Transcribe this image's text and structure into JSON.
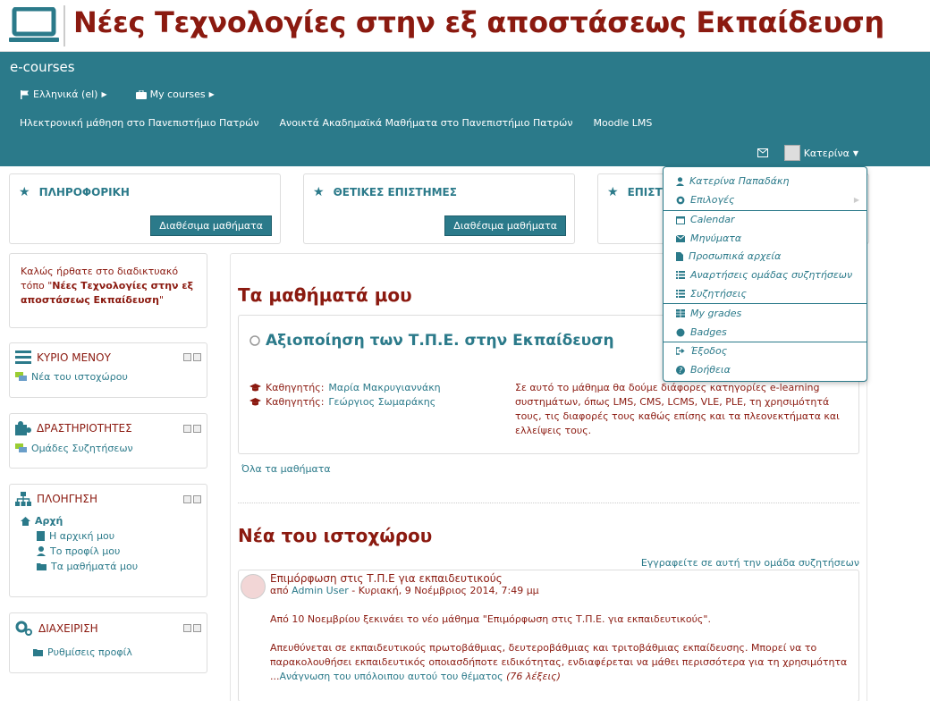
{
  "site_title": "Νέες Τεχνολογίες στην εξ αποστάσεως Εκπαίδευση",
  "brand": "e-courses",
  "nav": {
    "language": "Ελληνικά (el)",
    "my_courses": "My courses",
    "links": [
      "Ηλεκτρονική μάθηση στο Πανεπιστήμιο Πατρών",
      "Ανοικτά Ακαδημαϊκά Μαθήματα στο Πανεπιστήμιο Πατρών",
      "Moodle LMS"
    ],
    "user": "Κατερίνα"
  },
  "categories": [
    {
      "title": "ΠΛΗΡΟΦΟΡΙΚΗ",
      "button": "Διαθέσιμα μαθήματα"
    },
    {
      "title": "ΘΕΤΙΚΕΣ ΕΠΙΣΤΗΜΕΣ",
      "button": "Διαθέσιμα μαθήματα"
    },
    {
      "title": "ΕΠΙΣΤ"
    }
  ],
  "welcome": {
    "pre": "Καλώς ήρθατε στο διαδικτυακό τόπο \"",
    "name": "Νέες Τεχνολογίες στην εξ αποστάσεως Εκπαίδευση",
    "post": "\""
  },
  "blocks": {
    "main_menu": {
      "title": "ΚΥΡΙΟ ΜΕΝΟΥ",
      "items": [
        "Νέα του ιστοχώρου"
      ]
    },
    "activities": {
      "title": "ΔΡΑΣΤΗΡΙΟΤΗΤΕΣ",
      "items": [
        "Ομάδες Συζητήσεων"
      ]
    },
    "navigation": {
      "title": "ΠΛΟΗΓΗΣΗ",
      "home": "Αρχή",
      "items": [
        "Η αρχική μου",
        "Το προφίλ μου",
        "Τα μαθήματά μου"
      ]
    },
    "admin": {
      "title": "ΔΙΑΧΕΙΡΙΣΗ",
      "items": [
        "Ρυθμίσεις προφίλ"
      ]
    }
  },
  "my_courses": {
    "heading": "Τα μαθήματά μου",
    "course_title": "Αξιοποίηση των Τ.Π.Ε. στην Εκπαίδευση",
    "teacher_label": "Καθηγητής:",
    "teachers": [
      "Μαρία Μακρυγιαννάκη",
      "Γεώργιος Σωμαράκης"
    ],
    "summary": "Σε αυτό το μάθημα θα δούμε διάφορες κατηγορίες e-learning συστημάτων, όπως LMS, CMS, LCMS, VLE, PLE, τη χρησιμότητά τους, τις διαφορές τους καθώς επίσης και τα πλεονεκτήματα και ελλείψεις τους.",
    "all_courses": "Όλα τα μαθήματα"
  },
  "news": {
    "heading": "Νέα του ιστοχώρου",
    "subscribe": "Εγγραφείτε σε αυτή την ομάδα συζητήσεων",
    "subject": "Επιμόρφωση στις Τ.Π.Ε για εκπαιδευτικούς",
    "by": "από",
    "author": "Admin User",
    "date": "- Κυριακή, 9 Νοέμβριος 2014, 7:49 μμ",
    "p1": "Από 10 Νοεμβρίου ξεκινάει το νέο μάθημα  \"Επιμόρφωση στις Τ.Π.Ε. για εκπαιδευτικούς\".",
    "p2": "Απευθύνεται σε εκπαιδευτικούς πρωτοβάθμιας, δευτεροβάθμιας και τριτοβάθμιας εκπαίδευσης. Μπορεί να το παρακολουθήσει εκπαιδευτικός οποιασδήποτε ειδικότητας, ενδιαφέρεται να μάθει περισσότερα για τη χρησιμότητα",
    "read_more_prefix": "...",
    "read_more": "Ανάγνωση του υπόλοιπου αυτού του θέματος",
    "words": "(76 λέξεις)"
  },
  "user_menu": [
    {
      "label": "Κατερίνα Παπαδάκη",
      "icon": "user-icon"
    },
    {
      "label": "Επιλογές",
      "icon": "gear-icon"
    },
    {
      "label": "Calendar",
      "icon": "calendar-icon"
    },
    {
      "label": "Μηνύματα",
      "icon": "envelope-icon"
    },
    {
      "label": "Προσωπικά αρχεία",
      "icon": "file-icon"
    },
    {
      "label": "Αναρτήσεις ομάδας συζητήσεων",
      "icon": "list-icon"
    },
    {
      "label": "Συζητήσεις",
      "icon": "list-icon"
    },
    {
      "label": "My grades",
      "icon": "table-icon"
    },
    {
      "label": "Badges",
      "icon": "badge-icon"
    },
    {
      "label": "Έξοδος",
      "icon": "logout-icon"
    },
    {
      "label": "Βοήθεια",
      "icon": "help-icon"
    }
  ],
  "colors": {
    "teal": "#2b7a8a",
    "maroon": "#8b1a10"
  }
}
